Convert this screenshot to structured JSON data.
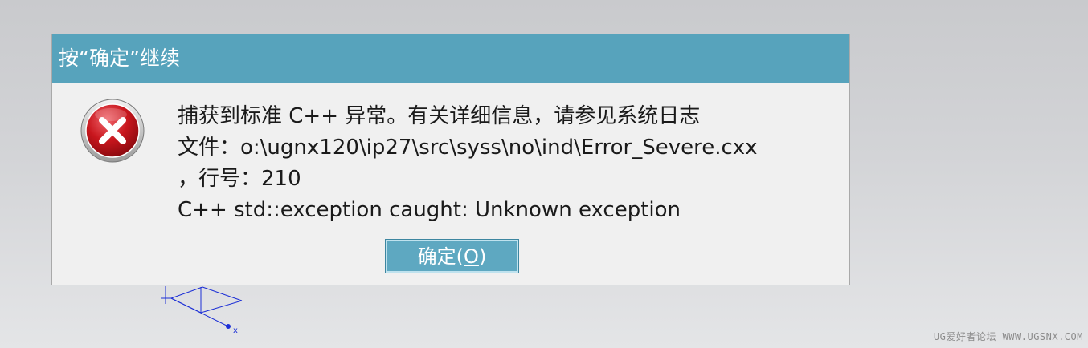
{
  "dialog": {
    "title": "按“确定”继续",
    "icon": "error-icon",
    "message_lines": [
      "捕获到标准 C++ 异常。有关详细信息，请参见系统日志",
      "文件：o:\\ugnx120\\ip27\\src\\syss\\no\\ind\\Error_Severe.cxx",
      "，行号：210",
      "C++ std::exception caught: Unknown exception"
    ],
    "ok_button_label": "确定(O)",
    "ok_button_mnemonic": "O"
  },
  "graphics": {
    "csys_axis_label": "x"
  },
  "watermark": "UG爱好者论坛 WWW.UGSNX.COM",
  "colors": {
    "title_bar": "#57a3bc",
    "button": "#5ea8c1",
    "error_red": "#c8161d",
    "csys_blue": "#1c2fd6"
  }
}
